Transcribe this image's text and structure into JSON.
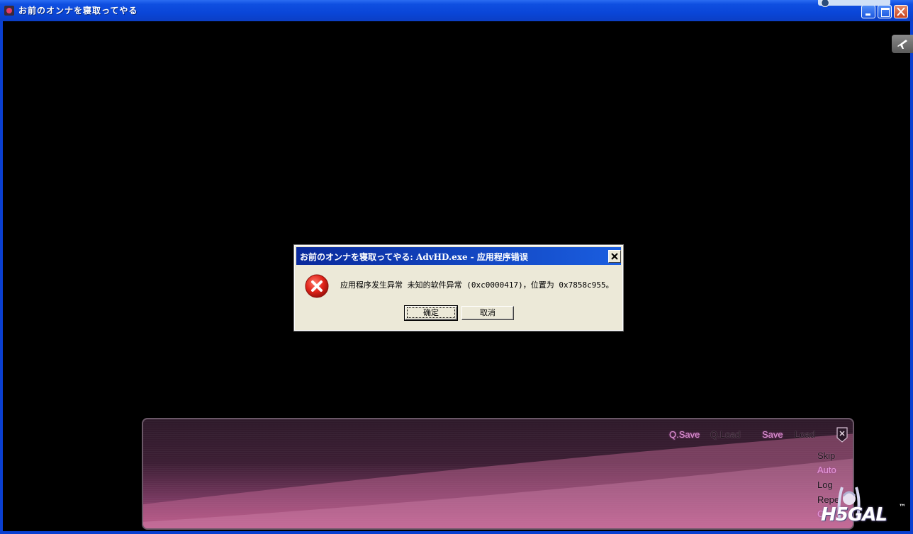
{
  "window": {
    "title": "お前のオンナを寝取ってやる"
  },
  "dialog": {
    "title": "お前のオンナを寝取ってやる: AdvHD.exe - 应用程序错误",
    "message": "应用程序发生异常 未知的软件异常 (0xc0000417)，位置为 0x7858c955。",
    "ok_label": "确定",
    "cancel_label": "取消",
    "icon": "error-icon"
  },
  "menu": {
    "qsave": "Q.Save",
    "qload": "Q.Load",
    "save": "Save",
    "load": "Load",
    "skip": "Skip",
    "auto": "Auto",
    "log": "Log",
    "repeat": "Repe",
    "config": "C"
  },
  "watermark": {
    "logo": "H5GAL",
    "tm": "™"
  },
  "colors": {
    "titlebar": "#0a46d8",
    "dialog_bg": "#ece9d8",
    "menu_active": "#e39ad9",
    "menu_idle": "#1b1218",
    "panel_pink": "#b2507f"
  }
}
